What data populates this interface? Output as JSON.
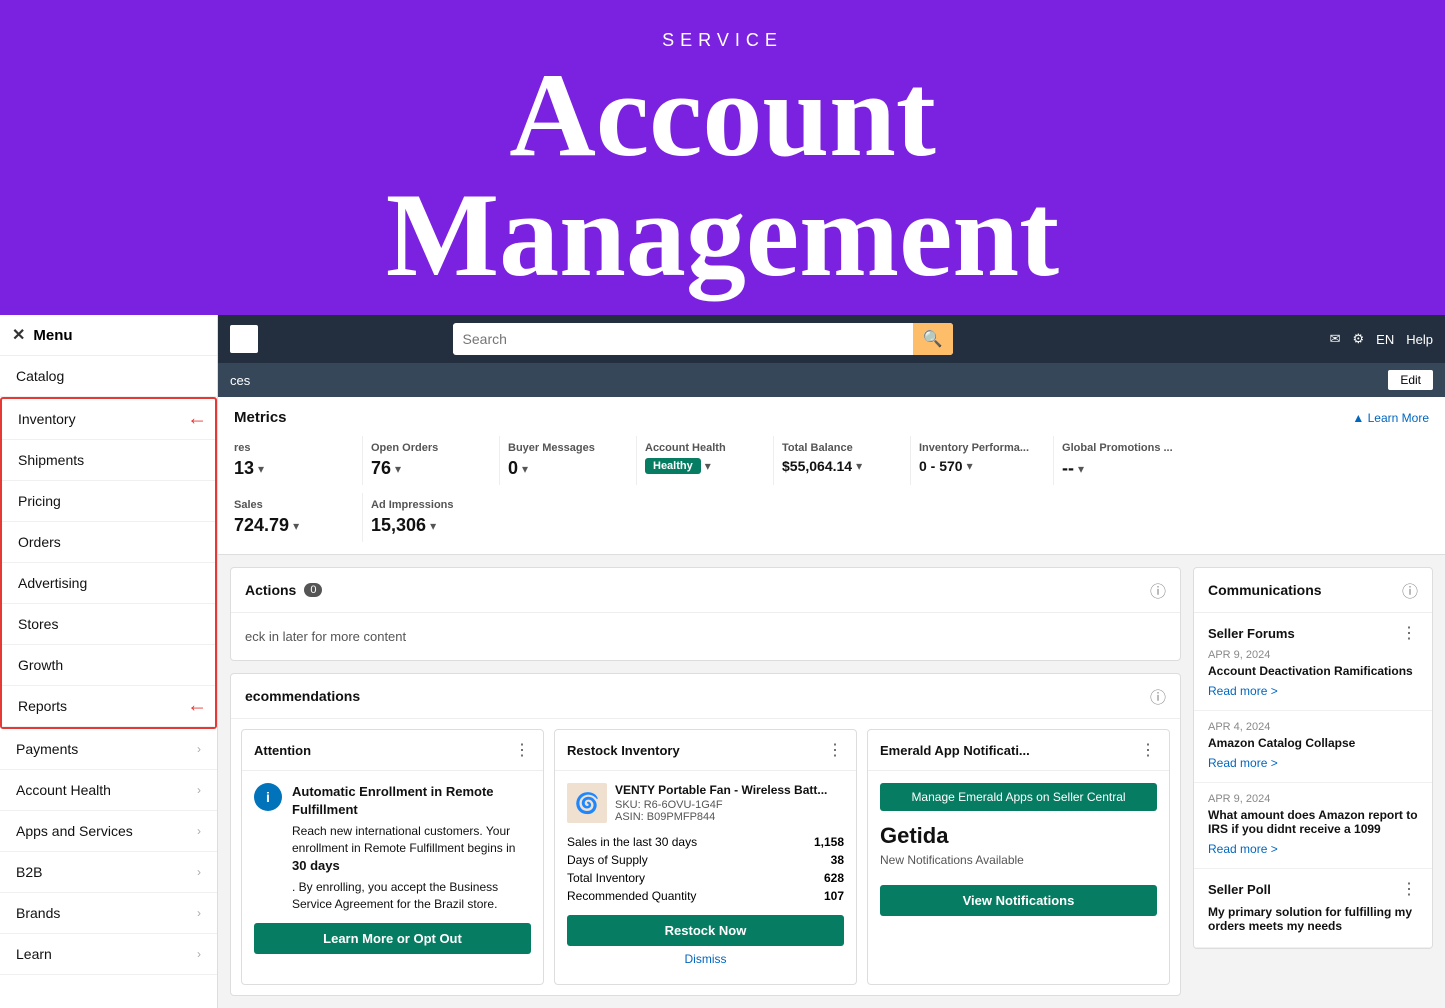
{
  "hero": {
    "service_label": "SERVICE",
    "title_line1": "Account",
    "title_line2": "Management"
  },
  "top_nav": {
    "search_placeholder": "Search",
    "lang": "EN",
    "help": "Help"
  },
  "sub_nav": {
    "text": "ces",
    "edit_label": "Edit"
  },
  "metrics": {
    "title": "Metrics",
    "learn_more": "▲ Learn More",
    "items": [
      {
        "label": "res",
        "value": "13",
        "has_dropdown": true
      },
      {
        "label": "Open Orders",
        "value": "76",
        "has_dropdown": true
      },
      {
        "label": "Buyer Messages",
        "value": "0",
        "has_dropdown": true
      },
      {
        "label": "Account Health",
        "value": "Healthy",
        "is_badge": true,
        "has_dropdown": true
      },
      {
        "label": "Total Balance",
        "value": "$55,064.14",
        "has_dropdown": true
      },
      {
        "label": "Inventory Performa...",
        "value": "0 - 570",
        "has_dropdown": true
      },
      {
        "label": "Global Promotions ...",
        "value": "--",
        "has_dropdown": true
      }
    ],
    "second_row": [
      {
        "label": "Sales",
        "value": "724.79",
        "has_dropdown": true
      },
      {
        "label": "Ad Impressions",
        "value": "15,306",
        "has_dropdown": true
      }
    ]
  },
  "sidebar": {
    "menu_label": "Menu",
    "items": [
      {
        "label": "Catalog",
        "has_arrow": false,
        "highlighted": false
      },
      {
        "label": "Inventory",
        "has_arrow": true,
        "highlighted": true,
        "red_arrow": true
      },
      {
        "label": "Shipments",
        "has_arrow": false,
        "highlighted": true
      },
      {
        "label": "Pricing",
        "has_arrow": false,
        "highlighted": false
      },
      {
        "label": "Orders",
        "has_arrow": false,
        "highlighted": false
      },
      {
        "label": "Advertising",
        "has_arrow": false,
        "highlighted": false
      },
      {
        "label": "Stores",
        "has_arrow": false,
        "highlighted": false
      },
      {
        "label": "Growth",
        "has_arrow": false,
        "highlighted": false
      },
      {
        "label": "Reports",
        "has_arrow": true,
        "highlighted": true,
        "red_arrow": true
      },
      {
        "label": "Payments",
        "has_chevron": true,
        "highlighted": false
      },
      {
        "label": "Account Health",
        "has_chevron": true,
        "highlighted": false
      },
      {
        "label": "Apps and Services",
        "has_chevron": true,
        "highlighted": false
      },
      {
        "label": "B2B",
        "has_chevron": true,
        "highlighted": false
      },
      {
        "label": "Brands",
        "has_chevron": true,
        "highlighted": false
      },
      {
        "label": "Learn",
        "has_chevron": true,
        "highlighted": false
      }
    ]
  },
  "actions_panel": {
    "title": "Actions",
    "count": 0,
    "empty_text": "eck in later for more content"
  },
  "recommendations_panel": {
    "title": "ecommendations",
    "cards": [
      {
        "title": "Attention",
        "icon_label": "i",
        "heading": "Automatic Enrollment in Remote Fulfillment",
        "body": "Reach new international customers. Your enrollment in Remote Fulfillment begins in 30 days. By enrolling, you accept the Business Service Agreement for the Brazil store.",
        "cta": "Learn More or Opt Out"
      },
      {
        "title": "Restock Inventory",
        "product_name": "VENTY Portable Fan - Wireless Batt...",
        "product_sku": "SKU: R6-6OVU-1G4F",
        "product_asin": "ASIN: B09PMFP844",
        "stats": [
          {
            "label": "Sales in the last 30 days",
            "value": "1,158"
          },
          {
            "label": "Days of Supply",
            "value": "38"
          },
          {
            "label": "Total Inventory",
            "value": "628"
          },
          {
            "label": "Recommended Quantity",
            "value": "107"
          }
        ],
        "cta": "Restock Now",
        "dismiss": "Dismiss"
      },
      {
        "title": "Emerald App Notificati...",
        "btn_label": "Manage Emerald Apps on Seller Central",
        "brand": "Getida",
        "sub": "New Notifications Available",
        "cta": "View Notifications"
      }
    ]
  },
  "communications": {
    "title": "Communications",
    "forums": [
      {
        "name": "Seller Forums",
        "date": "APR 9, 2024",
        "post_title": "Account Deactivation Ramifications",
        "read_more": "Read more >"
      },
      {
        "name": "",
        "date": "APR 4, 2024",
        "post_title": "Amazon Catalog Collapse",
        "read_more": "Read more >"
      },
      {
        "name": "",
        "date": "APR 9, 2024",
        "post_title": "What amount does Amazon report to IRS if you didnt receive a 1099",
        "read_more": "Read more >"
      }
    ],
    "poll_title": "Seller Poll",
    "poll_text": "My primary solution for fulfilling my orders meets my needs"
  }
}
